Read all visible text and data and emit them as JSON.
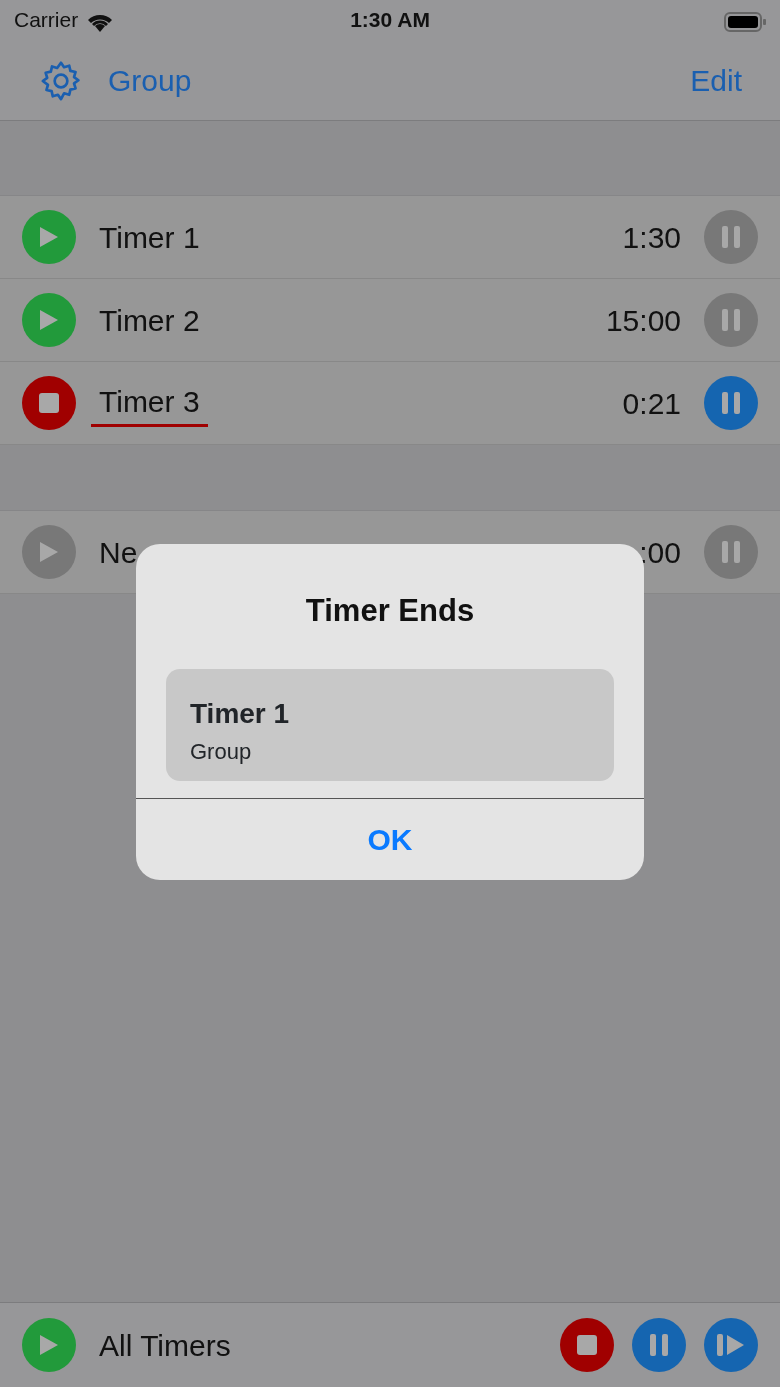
{
  "status_bar": {
    "carrier": "Carrier",
    "time": "1:30 AM"
  },
  "nav": {
    "title": "Group",
    "action": "Edit"
  },
  "timers": [
    {
      "name": "Timer 1",
      "time": "1:30",
      "running": false,
      "disabled": false
    },
    {
      "name": "Timer 2",
      "time": "15:00",
      "running": false,
      "disabled": false
    },
    {
      "name": "Timer 3",
      "time": "0:21",
      "running": true,
      "disabled": false
    }
  ],
  "new_timer": {
    "name": "Ne",
    "time": ":00",
    "running": false,
    "disabled": true
  },
  "dialog": {
    "title": "Timer Ends",
    "item_title": "Timer 1",
    "item_subtitle": "Group",
    "button": "OK"
  },
  "toolbar": {
    "label": "All Timers"
  }
}
